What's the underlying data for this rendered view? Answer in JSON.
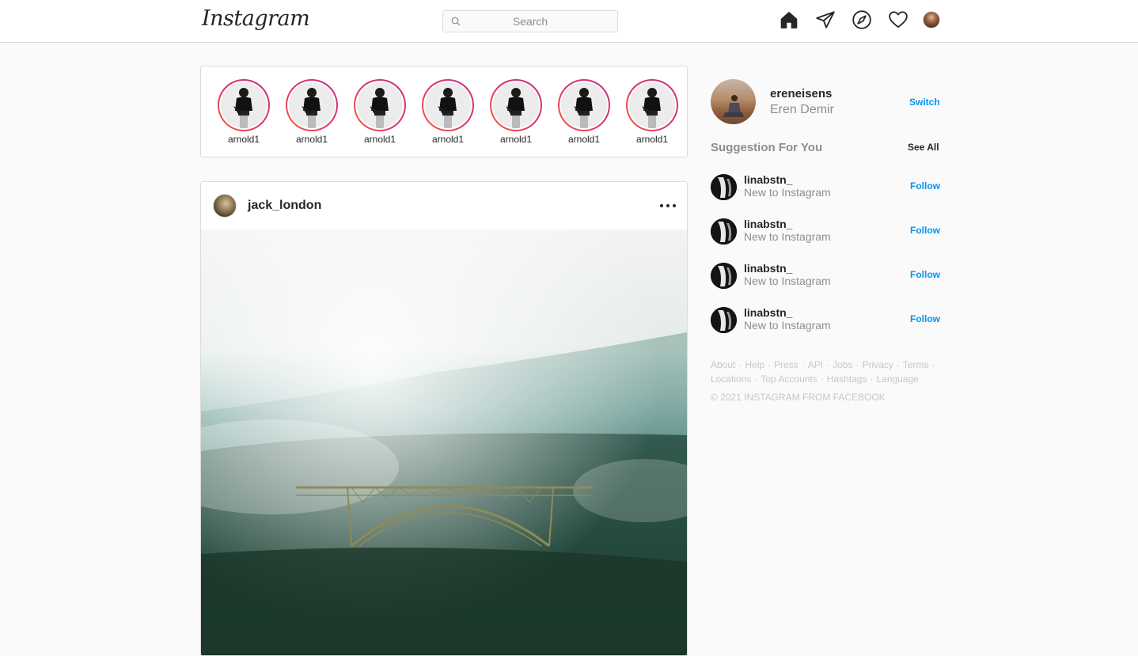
{
  "header": {
    "logo_text": "Instagram",
    "search_placeholder": "Search",
    "icons": [
      "home-icon",
      "paper-plane-icon",
      "compass-icon",
      "heart-icon"
    ]
  },
  "stories": [
    {
      "username": "arnold1"
    },
    {
      "username": "arnold1"
    },
    {
      "username": "arnold1"
    },
    {
      "username": "arnold1"
    },
    {
      "username": "arnold1"
    },
    {
      "username": "arnold1"
    },
    {
      "username": "arnold1"
    }
  ],
  "post": {
    "username": "jack_london",
    "more_icon": "more-dots-icon"
  },
  "profile": {
    "username": "ereneisens",
    "full_name": "Eren Demir",
    "switch_label": "Switch"
  },
  "suggestions": {
    "title": "Suggestion For You",
    "see_all_label": "See All",
    "items": [
      {
        "username": "linabstn_",
        "subtitle": "New to Instagram",
        "action": "Follow"
      },
      {
        "username": "linabstn_",
        "subtitle": "New to Instagram",
        "action": "Follow"
      },
      {
        "username": "linabstn_",
        "subtitle": "New to Instagram",
        "action": "Follow"
      },
      {
        "username": "linabstn_",
        "subtitle": "New to Instagram",
        "action": "Follow"
      }
    ]
  },
  "footer": {
    "links": [
      "About",
      "Help",
      "Press",
      "API",
      "Jobs",
      "Privacy",
      "Terms",
      "Locations",
      "Top Accounts",
      "Hashtags",
      "Language"
    ],
    "copyright": "© 2021 INSTAGRAM FROM FACEBOOK"
  },
  "colors": {
    "accent": "#0095f6",
    "story_ring_start": "#f56040",
    "story_ring_end": "#c13584",
    "muted_text": "#8e8e8e",
    "border": "#dbdbdb"
  }
}
